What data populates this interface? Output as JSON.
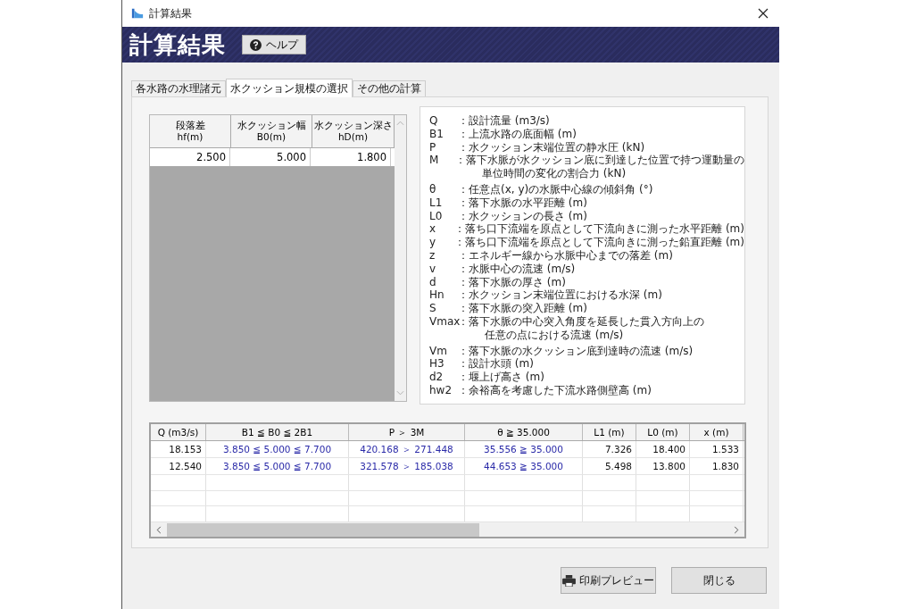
{
  "window": {
    "title": "計算結果"
  },
  "header": {
    "title": "計算結果",
    "help_button": "ヘルプ"
  },
  "tabs": [
    {
      "label": "各水路の水理諸元",
      "selected": false
    },
    {
      "label": "水クッション規模の選択",
      "selected": true
    },
    {
      "label": "その他の計算",
      "selected": false
    }
  ],
  "input_grid": {
    "columns": [
      {
        "label": "段落差",
        "unit": "hf(m)"
      },
      {
        "label": "水クッション幅",
        "unit": "B0(m)"
      },
      {
        "label": "水クッション深さ",
        "unit": "hD(m)"
      }
    ],
    "rows": [
      [
        "2.500",
        "5.000",
        "1.800"
      ]
    ]
  },
  "legend": [
    {
      "symbol": "Q",
      "lines": [
        "：設計流量 (m3/s)"
      ]
    },
    {
      "symbol": "B1",
      "lines": [
        "：上流水路の底面幅 (m)"
      ]
    },
    {
      "symbol": "P",
      "lines": [
        "：水クッション末端位置の静水圧 (kN)"
      ]
    },
    {
      "symbol": "M",
      "lines": [
        "：落下水脈が水クッション底に到達した位置で持つ運動量の",
        "単位時間の変化の割合力 (kN)"
      ]
    },
    {
      "symbol": "θ",
      "lines": [
        "：任意点(x, y)の水脈中心線の傾斜角 (°)"
      ]
    },
    {
      "symbol": "L1",
      "lines": [
        "：落下水脈の水平距離 (m)"
      ]
    },
    {
      "symbol": "L0",
      "lines": [
        "：水クッションの長さ (m)"
      ]
    },
    {
      "symbol": "x",
      "lines": [
        "：落ち口下流端を原点として下流向きに測った水平距離 (m)"
      ]
    },
    {
      "symbol": "y",
      "lines": [
        "：落ち口下流端を原点として下流向きに測った鉛直距離 (m)"
      ]
    },
    {
      "symbol": "z",
      "lines": [
        "：エネルギー線から水脈中心までの落差 (m)"
      ]
    },
    {
      "symbol": "v",
      "lines": [
        "：水脈中心の流速 (m/s)"
      ]
    },
    {
      "symbol": "d",
      "lines": [
        "：落下水脈の厚さ (m)"
      ]
    },
    {
      "symbol": "Hn",
      "lines": [
        "：水クッション末端位置における水深 (m)"
      ]
    },
    {
      "symbol": "S",
      "lines": [
        "：落下水脈の突入距離 (m)"
      ]
    },
    {
      "symbol": "Vmax",
      "lines": [
        "：落下水脈の中心突入角度を延長した貫入方向上の",
        "任意の点における流速 (m/s)"
      ]
    },
    {
      "symbol": "Vm",
      "lines": [
        "：落下水脈の水クッション底到達時の流速 (m/s)"
      ]
    },
    {
      "symbol": "H3",
      "lines": [
        "：設計水頭 (m)"
      ]
    },
    {
      "symbol": "d2",
      "lines": [
        "：堰上げ高さ (m)"
      ]
    },
    {
      "symbol": "hw2",
      "lines": [
        "：余裕高を考慮した下流水路側壁高 (m)"
      ]
    }
  ],
  "result_grid": {
    "columns": [
      {
        "label": "Q (m3/s)",
        "kind": "value"
      },
      {
        "label": "B1 ≦ B0 ≦ 2B1",
        "kind": "check"
      },
      {
        "label": "P ＞ 3M",
        "kind": "check"
      },
      {
        "label": "θ ≧ 35.000",
        "kind": "check"
      },
      {
        "label": "L1 (m)",
        "kind": "value"
      },
      {
        "label": "L0 (m)",
        "kind": "value"
      },
      {
        "label": "x (m)",
        "kind": "value"
      }
    ],
    "rows": [
      [
        "18.153",
        "3.850 ≦ 5.000 ≦ 7.700",
        "420.168 ＞ 271.448",
        "35.556 ≧ 35.000",
        "7.326",
        "18.400",
        "1.533"
      ],
      [
        "12.540",
        "3.850 ≦ 5.000 ≦ 7.700",
        "321.578 ＞ 185.038",
        "44.653 ≧ 35.000",
        "5.498",
        "13.800",
        "1.830"
      ]
    ]
  },
  "buttons": [
    {
      "label": "印刷プレビュー",
      "kind": "print"
    },
    {
      "label": "閉じる",
      "kind": "plain"
    }
  ]
}
